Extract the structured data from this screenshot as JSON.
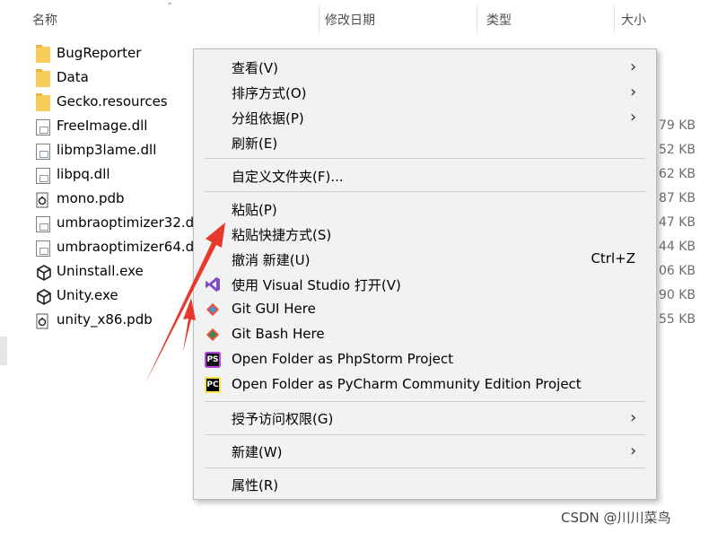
{
  "columns": {
    "name": "名称",
    "modified": "修改日期",
    "type": "类型",
    "size": "大小"
  },
  "files": [
    {
      "name": "BugReporter",
      "kind": "folder-icon",
      "size": ""
    },
    {
      "name": "Data",
      "kind": "folder-icon",
      "size": ""
    },
    {
      "name": "Gecko.resources",
      "kind": "folder-icon",
      "size": ""
    },
    {
      "name": "FreeImage.dll",
      "kind": "dll-file-icon",
      "size": "79 KB"
    },
    {
      "name": "libmp3lame.dll",
      "kind": "dll-file-icon",
      "size": "52 KB"
    },
    {
      "name": "libpq.dll",
      "kind": "dll-file-icon",
      "size": "62 KB"
    },
    {
      "name": "mono.pdb",
      "kind": "pdb-file-icon",
      "size": "87 KB"
    },
    {
      "name": "umbraoptimizer32.dll",
      "kind": "dll-file-icon",
      "size": "47 KB"
    },
    {
      "name": "umbraoptimizer64.dll",
      "kind": "dll-file-icon",
      "size": "44 KB"
    },
    {
      "name": "Uninstall.exe",
      "kind": "unity-icon",
      "size": "06 KB"
    },
    {
      "name": "Unity.exe",
      "kind": "unity-icon",
      "size": "90 KB"
    },
    {
      "name": "unity_x86.pdb",
      "kind": "pdb-file-icon",
      "size": "55 KB"
    }
  ],
  "menu": {
    "view": {
      "label": "查看(V)"
    },
    "sort": {
      "label": "排序方式(O)"
    },
    "group": {
      "label": "分组依据(P)"
    },
    "refresh": {
      "label": "刷新(E)"
    },
    "customize": {
      "label": "自定义文件夹(F)..."
    },
    "paste": {
      "label": "粘贴(P)"
    },
    "paste_shortcut": {
      "label": "粘贴快捷方式(S)"
    },
    "undo": {
      "label": "撤消 新建(U)",
      "shortcut": "Ctrl+Z"
    },
    "open_vs": {
      "label": "使用 Visual Studio 打开(V)",
      "icon": "visual-studio-icon"
    },
    "git_gui": {
      "label": "Git GUI Here",
      "icon": "git-gui-icon"
    },
    "git_bash": {
      "label": "Git Bash Here",
      "icon": "git-bash-icon"
    },
    "phpstorm": {
      "label": "Open Folder as PhpStorm Project",
      "icon": "phpstorm-icon",
      "icon_text": "PS"
    },
    "pycharm": {
      "label": "Open Folder as PyCharm Community Edition Project",
      "icon": "pycharm-icon",
      "icon_text": "PC"
    },
    "grant_access": {
      "label": "授予访问权限(G)"
    },
    "new": {
      "label": "新建(W)"
    },
    "properties": {
      "label": "属性(R)"
    }
  },
  "chevron": "›",
  "watermark": "CSDN @川川菜鸟",
  "colors": {
    "menu_bg": "#f2f2f2",
    "arrow": "#e8382c",
    "folder": "#f8cd5a"
  }
}
